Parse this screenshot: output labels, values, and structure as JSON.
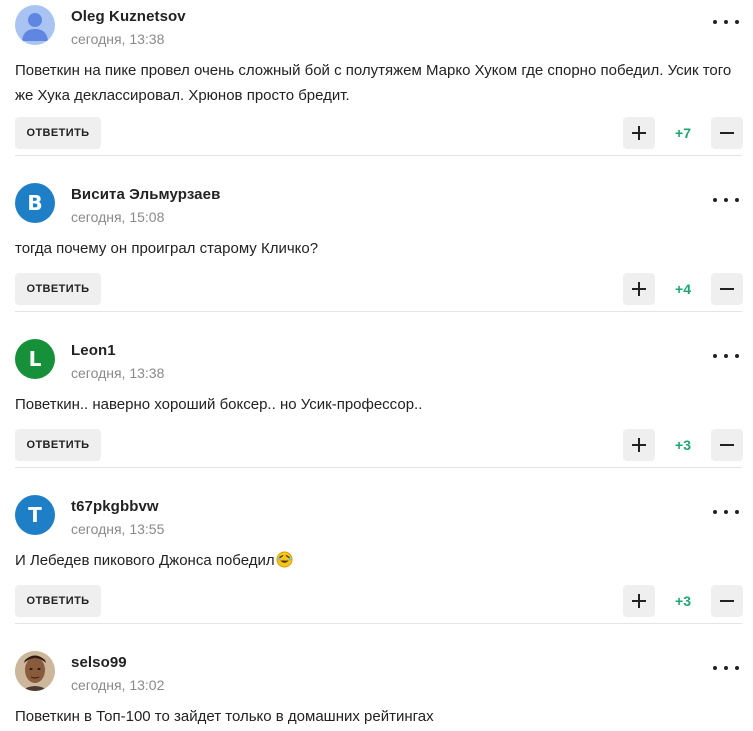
{
  "colors": {
    "accent_positive": "#1ea672",
    "button_bg": "#efefef",
    "meta_text": "#8a8a8a"
  },
  "actions": {
    "reply_label": "ОТВЕТИТЬ",
    "more_icon": "ellipsis-icon",
    "upvote_icon": "plus-icon",
    "downvote_icon": "minus-icon"
  },
  "comments": [
    {
      "author": "Oleg Kuznetsov",
      "timestamp": "сегодня, 13:38",
      "text": "Поветкин на пике провел очень сложный бой с полутяжем Марко Хуком где спорно победил. Усик того же Хука деклассировал. Хрюнов просто бредит.",
      "score": "+7",
      "avatar": {
        "type": "default-user-icon",
        "color": "#a9c3f2"
      }
    },
    {
      "author": "Висита Эльмурзаев",
      "timestamp": "сегодня, 15:08",
      "text": "тогда почему он проиграл старому Кличко?",
      "score": "+4",
      "avatar": {
        "type": "initial",
        "initial": "В",
        "color": "#1e7fc7"
      }
    },
    {
      "author": "Leon1",
      "timestamp": "сегодня, 13:38",
      "text": "Поветкин.. наверно хороший боксер.. но Усик-профессор..",
      "score": "+3",
      "avatar": {
        "type": "initial",
        "initial": "L",
        "color": "#16913a"
      }
    },
    {
      "author": "t67pkgbbvw",
      "timestamp": "сегодня, 13:55",
      "text": "И Лебедев пикового Джонса победил",
      "emoji": "rolling-on-floor-laughing-emoji",
      "score": "+3",
      "avatar": {
        "type": "initial",
        "initial": "T",
        "color": "#1e7fc7"
      }
    },
    {
      "author": "selso99",
      "timestamp": "сегодня, 13:02",
      "text": "Поветкин в Топ-100 то зайдет только в домашних рейтингах",
      "avatar": {
        "type": "photo",
        "color": "#8a5a3c"
      }
    }
  ]
}
